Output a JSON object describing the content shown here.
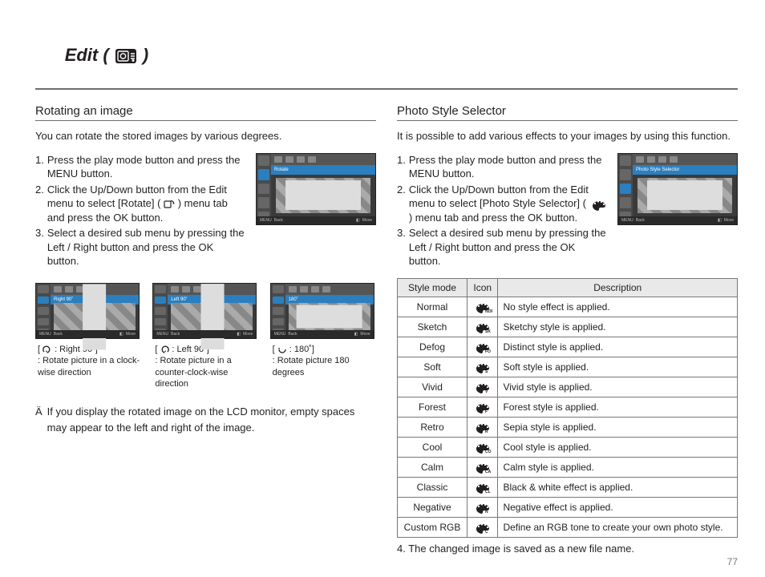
{
  "page_number": "77",
  "title_prefix": "Edit ( ",
  "title_suffix": " )",
  "left": {
    "heading": "Rotating an image",
    "intro": "You can rotate the stored images by various degrees.",
    "steps": [
      {
        "num": "1.",
        "text_a": "Press the play mode button and press the MENU button."
      },
      {
        "num": "2.",
        "text_a": "Click the Up/Down button from the Edit menu to select [Rotate] ( ",
        "has_icon": true,
        "text_b": " ) menu tab and press the OK button."
      },
      {
        "num": "3.",
        "text_a": "Select a desired sub menu by pressing the Left / Right button and press the OK button."
      }
    ],
    "screen_main": {
      "tab_label": "Rotate",
      "back": "Back",
      "move": "Move"
    },
    "rots": [
      {
        "tab_label": "Right 90˚",
        "back": "Back",
        "move": "Move",
        "cap_bracket": " : Right 90˚]",
        "cap_desc": ": Rotate picture in a clock-wise direction",
        "rot_class": "rot90cw"
      },
      {
        "tab_label": "Left 90˚",
        "back": "Back",
        "move": "Move",
        "cap_bracket": " : Left 90˚]",
        "cap_desc": ": Rotate picture in a counter-clock-wise direction",
        "rot_class": "rot90ccw"
      },
      {
        "tab_label": "180˚",
        "back": "Back",
        "move": "Move",
        "cap_bracket": " : 180˚]",
        "cap_desc": ": Rotate picture 180 degrees",
        "rot_class": "rot180"
      }
    ],
    "note_mark": "Ä",
    "note": "If you display the rotated image on the LCD monitor, empty spaces may appear to the left and right of the image."
  },
  "right": {
    "heading": "Photo Style Selector",
    "intro": "It is possible to add various effects to your images by using this function.",
    "steps": [
      {
        "num": "1.",
        "text_a": "Press the play mode button and press the MENU button."
      },
      {
        "num": "2.",
        "text_a": "Click the Up/Down button from the Edit menu to select [Photo Style Selector] ( ",
        "has_icon": true,
        "text_b": " ) menu tab and press the OK button."
      },
      {
        "num": "3.",
        "text_a": "Select a desired sub menu by pressing the Left / Right button and press the OK button."
      }
    ],
    "screen_main": {
      "tab_label": "Photo Style Selector",
      "back": "Back",
      "move": "Move"
    },
    "table": {
      "headers": [
        "Style mode",
        "Icon",
        "Description"
      ],
      "rows": [
        {
          "mode": "Normal",
          "sub": "NOR",
          "desc": "No style effect is applied."
        },
        {
          "mode": "Sketch",
          "sub": "SK",
          "desc": "Sketchy style is applied."
        },
        {
          "mode": "Defog",
          "sub": "FO",
          "desc": "Distinct style is applied."
        },
        {
          "mode": "Soft",
          "sub": "S",
          "desc": "Soft style is applied."
        },
        {
          "mode": "Vivid",
          "sub": "V",
          "desc": "Vivid style is applied."
        },
        {
          "mode": "Forest",
          "sub": "F",
          "desc": "Forest style is applied."
        },
        {
          "mode": "Retro",
          "sub": "R",
          "desc": "Sepia style is applied."
        },
        {
          "mode": "Cool",
          "sub": "CO",
          "desc": "Cool style is applied."
        },
        {
          "mode": "Calm",
          "sub": "CA",
          "desc": "Calm style is applied."
        },
        {
          "mode": "Classic",
          "sub": "CL",
          "desc": "Black & white effect is applied."
        },
        {
          "mode": "Negative",
          "sub": "N",
          "desc": "Negative effect is applied."
        },
        {
          "mode": "Custom RGB",
          "sub": "C",
          "desc": "Define an RGB tone to create your own photo style."
        }
      ]
    },
    "after_table_num": "4. ",
    "after_table": "The changed image is saved as a new file name."
  }
}
